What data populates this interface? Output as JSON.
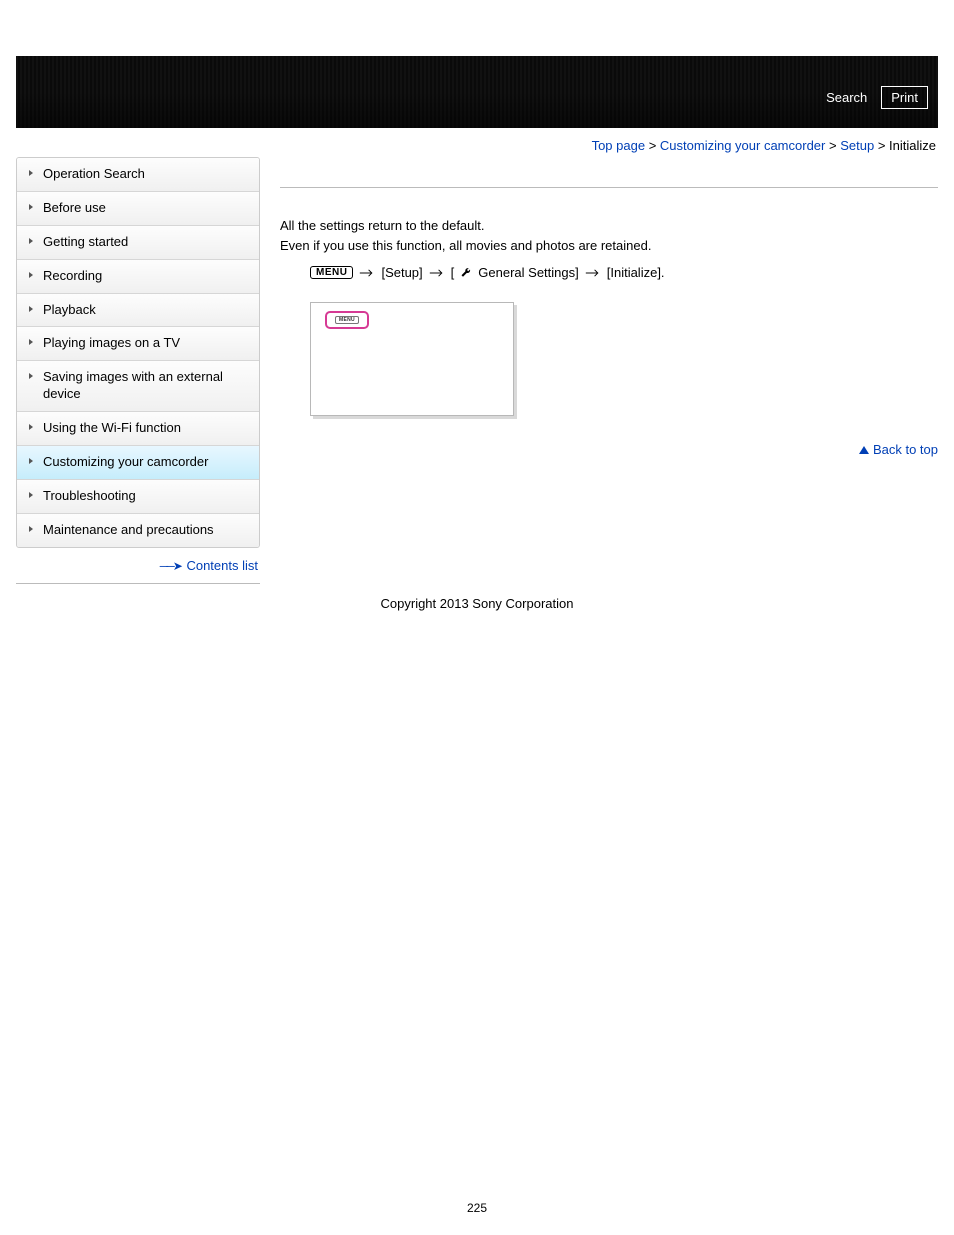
{
  "header": {
    "search": "Search",
    "print": "Print"
  },
  "breadcrumb": {
    "top_page": "Top page",
    "sep": ">",
    "customizing": "Customizing your camcorder",
    "setup": "Setup",
    "current": "Initialize"
  },
  "sidebar": {
    "items": [
      {
        "label": "Operation Search"
      },
      {
        "label": "Before use"
      },
      {
        "label": "Getting started"
      },
      {
        "label": "Recording"
      },
      {
        "label": "Playback"
      },
      {
        "label": "Playing images on a TV"
      },
      {
        "label": "Saving images with an external device"
      },
      {
        "label": "Using the Wi-Fi function"
      },
      {
        "label": "Customizing your camcorder"
      },
      {
        "label": "Troubleshooting"
      },
      {
        "label": "Maintenance and precautions"
      }
    ],
    "contents_link": "Contents list"
  },
  "content": {
    "line1": "All the settings return to the default.",
    "line2": "Even if you use this function, all movies and photos are retained.",
    "menu_label": "MENU",
    "path_setup": "[Setup]",
    "path_general_prefix": "[",
    "path_general": "General Settings]",
    "path_initialize": "[Initialize].",
    "mini_menu_text": "MENU"
  },
  "back_to_top": "Back to top",
  "copyright": "Copyright 2013 Sony Corporation",
  "page_number": "225"
}
